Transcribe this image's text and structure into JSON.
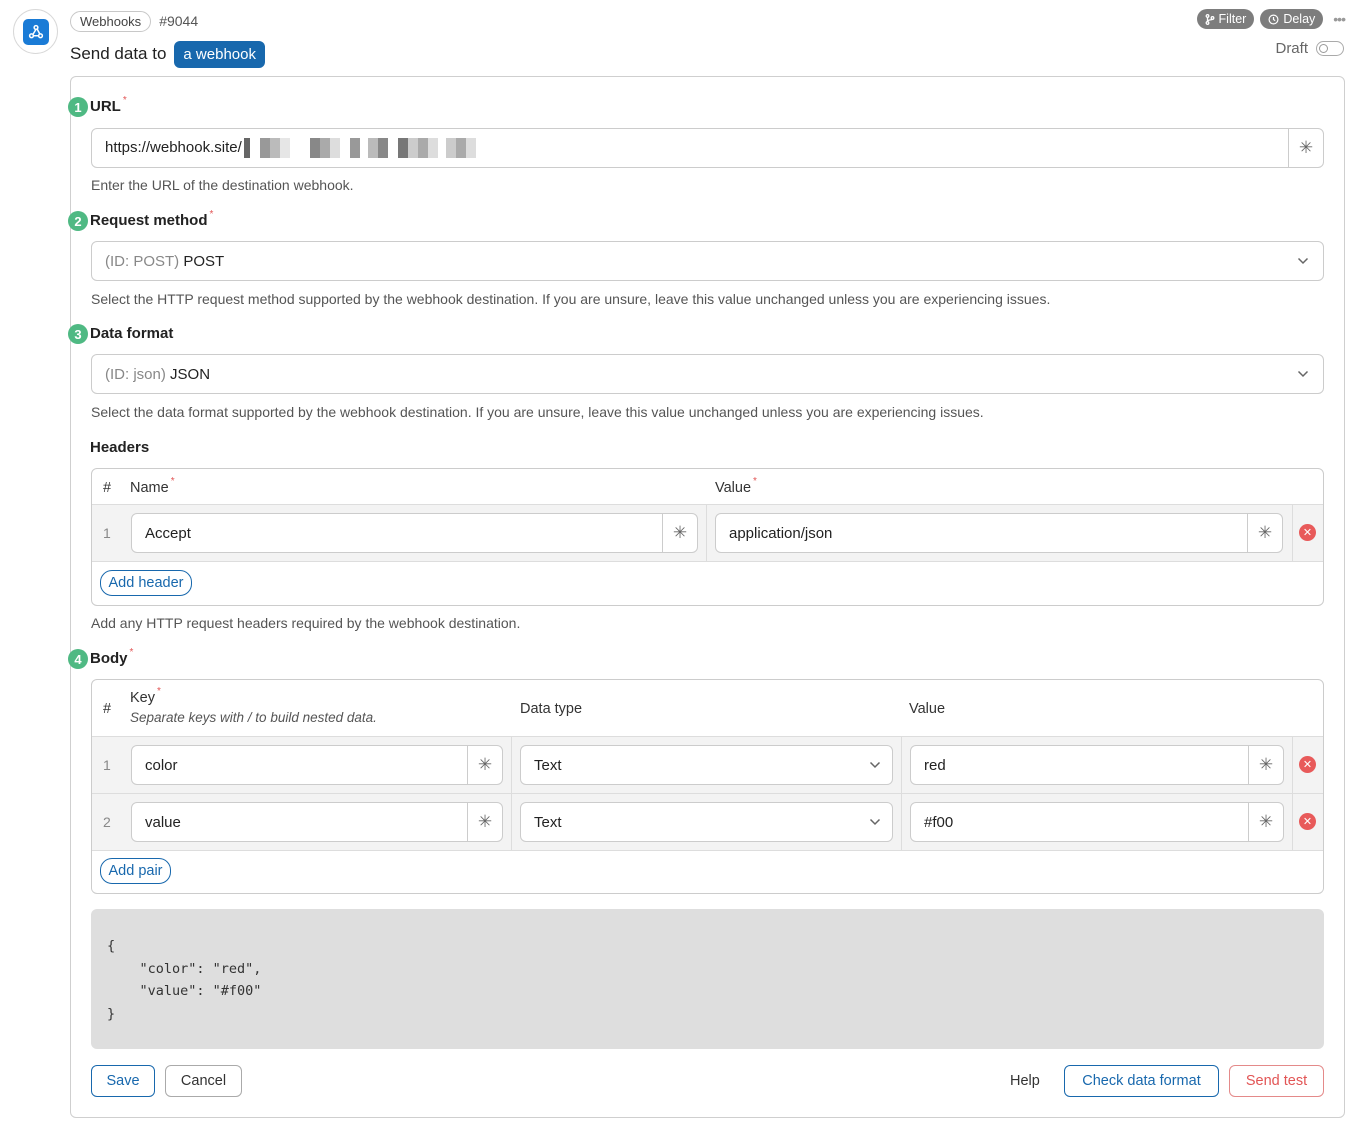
{
  "header": {
    "app_pill": "Webhooks",
    "step_id": "#9044",
    "title_prefix": "Send data to",
    "title_pill": "a webhook",
    "filter_label": "Filter",
    "delay_label": "Delay",
    "draft_label": "Draft",
    "draft_enabled": false
  },
  "fields": {
    "url": {
      "number": "1",
      "label": "URL",
      "value": "https://webhook.site/",
      "help": "Enter the URL of the destination webhook."
    },
    "method": {
      "number": "2",
      "label": "Request method",
      "id_prefix": "(ID: POST)",
      "value": "POST",
      "help": "Select the HTTP request method supported by the webhook destination. If you are unsure, leave this value unchanged unless you are experiencing issues."
    },
    "format": {
      "number": "3",
      "label": "Data format",
      "id_prefix": "(ID: json)",
      "value": "JSON",
      "help": "Select the data format supported by the webhook destination. If you are unsure, leave this value unchanged unless you are experiencing issues."
    }
  },
  "headers": {
    "label": "Headers",
    "col_num": "#",
    "col_name": "Name",
    "col_value": "Value",
    "rows": [
      {
        "num": "1",
        "name": "Accept",
        "value": "application/json"
      }
    ],
    "add_label": "Add header",
    "help": "Add any HTTP request headers required by the webhook destination."
  },
  "body": {
    "number": "4",
    "label": "Body",
    "col_num": "#",
    "col_key": "Key",
    "col_key_hint": "Separate keys with / to build nested data.",
    "col_type": "Data type",
    "col_value": "Value",
    "rows": [
      {
        "num": "1",
        "key": "color",
        "type": "Text",
        "value": "red"
      },
      {
        "num": "2",
        "key": "value",
        "type": "Text",
        "value": "#f00"
      }
    ],
    "add_label": "Add pair",
    "preview": "{\n    \"color\": \"red\",\n    \"value\": \"#f00\"\n}"
  },
  "footer": {
    "save": "Save",
    "cancel": "Cancel",
    "help": "Help",
    "check": "Check data format",
    "send_test": "Send test"
  },
  "colors": {
    "accent": "#1868ad",
    "step_badge": "#4fb983",
    "danger": "#e25555",
    "app_icon": "#1a7bd6"
  }
}
